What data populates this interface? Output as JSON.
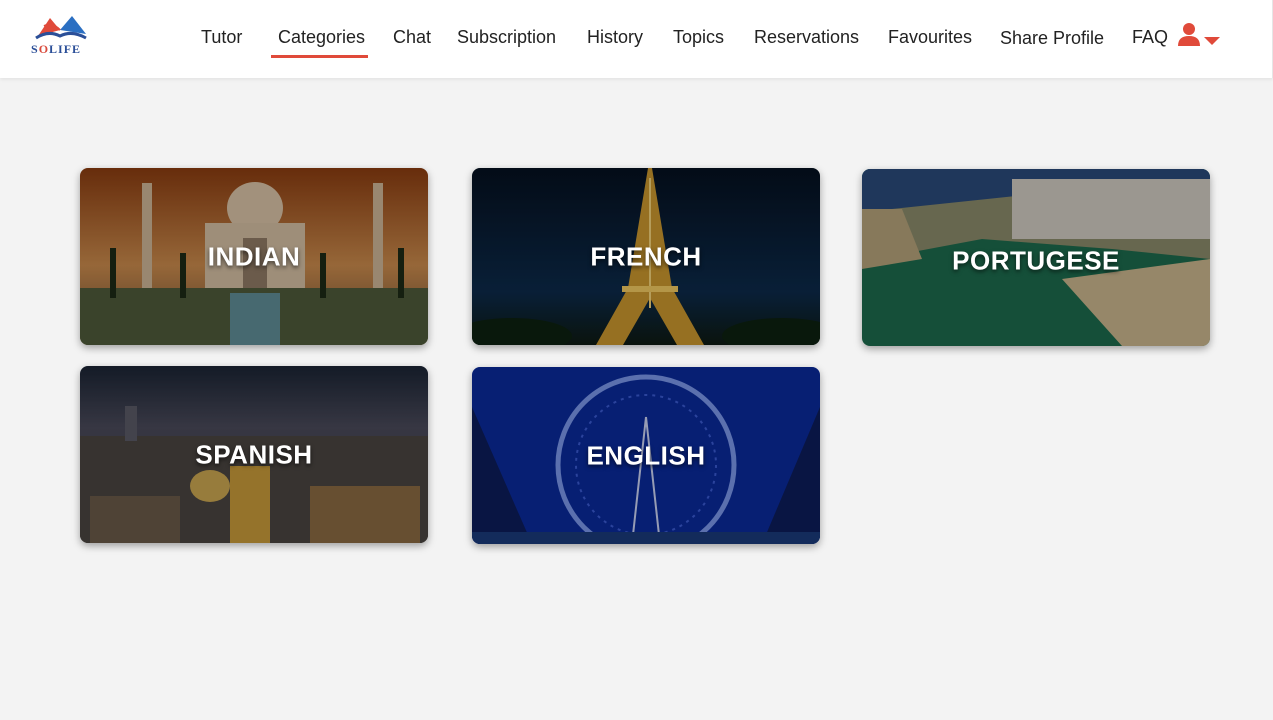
{
  "brand": {
    "logo_text_prefix": "S",
    "logo_text_o": "O",
    "logo_text_rest": "LIFE"
  },
  "nav": {
    "items": [
      {
        "label": "Tutor"
      },
      {
        "label": "Categories",
        "active": true
      },
      {
        "label": "Chat"
      },
      {
        "label": "Subscription"
      },
      {
        "label": "History"
      },
      {
        "label": "Topics"
      },
      {
        "label": "Reservations"
      },
      {
        "label": "Favourites"
      },
      {
        "label": "Share Profile"
      },
      {
        "label": "FAQ"
      }
    ],
    "user_icon": "user-icon",
    "dropdown_icon": "caret-down-icon"
  },
  "categories": [
    {
      "label": "INDIAN",
      "image": "taj-mahal"
    },
    {
      "label": "FRENCH",
      "image": "eiffel-tower"
    },
    {
      "label": "PORTUGESE",
      "image": "coastal-town"
    },
    {
      "label": "SPANISH",
      "image": "madrid-skyline"
    },
    {
      "label": "ENGLISH",
      "image": "london-eye"
    }
  ],
  "colors": {
    "accent": "#e04a3a",
    "brand_blue": "#2b4f98",
    "page_bg": "#f3f3f3"
  }
}
